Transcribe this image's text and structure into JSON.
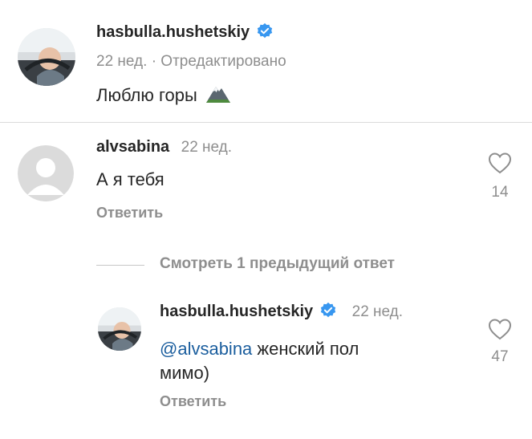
{
  "post": {
    "username": "hasbulla.hushetskiy",
    "meta": "22 нед. · Отредактировано",
    "text": "Люблю горы"
  },
  "comment": {
    "username": "alvsabina",
    "time": "22 нед.",
    "text": "А я тебя",
    "reply_label": "Ответить",
    "likes": "14"
  },
  "view_replies": "Смотреть 1 предыдущий ответ",
  "reply": {
    "username": "hasbulla.hushetskiy",
    "time": "22 нед.",
    "mention": "@alvsabina",
    "text_line1": "женский пол",
    "text_line2": "мимо)",
    "reply_label": "Ответить",
    "likes": "47"
  },
  "colors": {
    "verified": "#3897f0",
    "mention": "#1b5e9e",
    "muted": "#8e8e8e"
  },
  "icons": [
    "verified-badge-icon",
    "mountain-emoji-icon",
    "heart-outline-icon",
    "default-avatar-icon"
  ]
}
